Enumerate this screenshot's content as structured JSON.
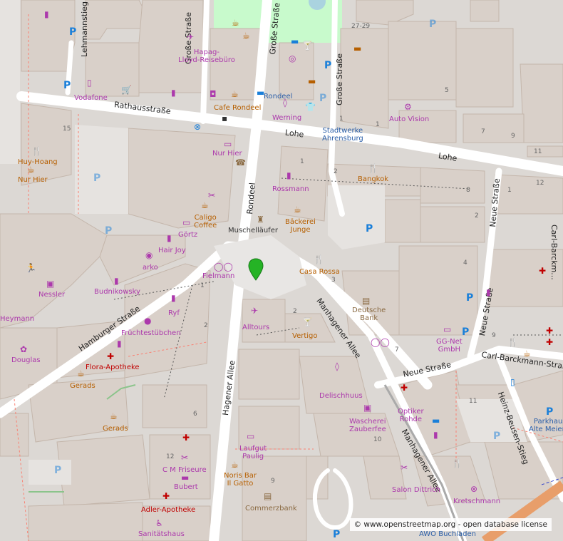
{
  "map": {
    "streets": {
      "rathausstrasse": "Rathausstraße",
      "lohe": "Lohe",
      "lohe2": "Lohe",
      "grosse_strasse_1": "Große Straße",
      "grosse_strasse_2": "Große Straße",
      "grosse_strasse_3": "Große Straße",
      "rondeel_street": "Rondeel",
      "hamburger_strasse": "Hamburger Straße",
      "hagener_allee": "Hagener Allee",
      "manhagener_allee_1": "Manhagener Allee",
      "manhagener_allee_2": "Manhagener Allee",
      "neue_strasse_1": "Neue Straße",
      "neue_strasse_2": "Neue Straße",
      "neue_strasse_3": "Neue Straße",
      "carl_barckmann": "Carl-Barckmann-Straße",
      "heinz_beusen": "Heinz-Beusen-Stieg",
      "lehmannstieg": "Lehmannstieg",
      "carl_barckmann_side": "Carl-Barckm..."
    },
    "places": {
      "hapag": "Hapag-\nLloyd-Reisebüro",
      "vodafone": "Vodafone",
      "cafe_rondeel": "Cafe Rondeel",
      "rondeel": "Rondeel",
      "werning": "Werning",
      "stadtwerke": "Stadtwerke\nAhrensburg",
      "auto_vision": "Auto Vision",
      "huy_hoang": "Huy-Hoang",
      "nur_hier_1": "Nur Hier",
      "nur_hier_2": "Nur Hier",
      "rossmann": "Rossmann",
      "bangkok": "Bangkok",
      "caligo": "Caligo\nCoffee",
      "gortz": "Görtz",
      "hair_joy": "Hair Joy",
      "arko": "arko",
      "muschellaeufer": "Muschelläufer",
      "baeckerei": "Bäckerei\nJunge",
      "casa_rossa": "Casa Rossa",
      "fielmann": "Fielmann",
      "nessler": "Nessler",
      "budnikowsky": "Budnikowsky",
      "heymann": "Heymann",
      "ryf": "Ryf",
      "deutsche_bank": "Deutsche\nBank",
      "alltours": "Alltours",
      "vertigo": "Vertigo",
      "fruechtestuebchen": "Früchtestübchen",
      "douglas": "Douglas",
      "flora": "Flora-Apotheke",
      "gerads_1": "Gerads",
      "gerads_2": "Gerads",
      "gg_net": "GG-Net\nGmbH",
      "delischhuus": "Delischhuus",
      "optiker_rohde": "Optiker\nRohde",
      "wascherei": "Wascherei\nZauberfee",
      "laufgut": "Laufgut\nPaulig",
      "cm_friseure": "C M Friseure",
      "bubert": "Bubert",
      "noris_bar": "Noris Bar\nIl Gatto",
      "commerzbank": "Commerzbank",
      "adler": "Adler-Apotheke",
      "sanitaetshaus": "Sanitätshaus",
      "salon_dittrich": "Salon Dittrich",
      "kretschmann": "Kretschmann",
      "awo": "AWO Buchladen",
      "parkhaus": "Parkhaus\nAlte Meierei"
    },
    "house_numbers": {
      "n15": "15",
      "n27_29": "27-29",
      "n5": "5",
      "n1a": "1",
      "n7a": "7",
      "n9a": "9",
      "n11a": "11",
      "n1b": "1",
      "n2a": "2",
      "n8": "8",
      "n1c": "1",
      "n12a": "12",
      "n2b": "2",
      "n4": "4",
      "n3": "3",
      "n2c": "2",
      "n1d": "1",
      "n2d": "2",
      "n7b": "7",
      "n9b": "9",
      "n6": "6",
      "n12b": "12",
      "n10": "10",
      "n9c": "9",
      "n11b": "11",
      "n1e": "1"
    },
    "attribution": "© www.openstreetmap.org - open database license",
    "colors": {
      "building": "#d9d0c9",
      "building_outline": "#c4b6ab",
      "road": "#ffffff",
      "ground": "#dcd8d4",
      "park": "#c8facc",
      "water": "#aad3df",
      "poi": "#ac39ac",
      "food": "#b65f00",
      "parking": "#1a7fd9",
      "pharmacy": "#c00000",
      "marker": "#25b325"
    }
  }
}
